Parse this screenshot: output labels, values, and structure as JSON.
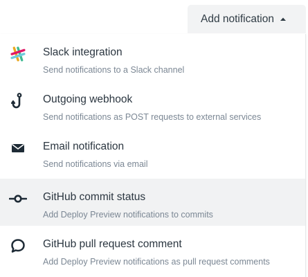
{
  "header": {
    "add_button_label": "Add notification",
    "add_button_icon": "chevron-up-icon"
  },
  "menu": {
    "items": [
      {
        "title": "Slack integration",
        "description": "Send notifications to a Slack channel",
        "icon": "slack-icon"
      },
      {
        "title": "Outgoing webhook",
        "description": "Send notifications as POST requests to external services",
        "icon": "webhook-hook-icon"
      },
      {
        "title": "Email notification",
        "description": "Send notifications via email",
        "icon": "envelope-icon"
      },
      {
        "title": "GitHub commit status",
        "description": "Add Deploy Preview notifications to commits",
        "icon": "git-commit-icon",
        "highlighted": true
      },
      {
        "title": "GitHub pull request comment",
        "description": "Add Deploy Preview notifications as pull request comments",
        "icon": "speech-bubble-icon"
      }
    ]
  },
  "colors": {
    "text_primary": "#2b3640",
    "text_secondary": "#7b8794",
    "hover_background": "#f1f2f3",
    "button_background": "#f2f3f4"
  }
}
